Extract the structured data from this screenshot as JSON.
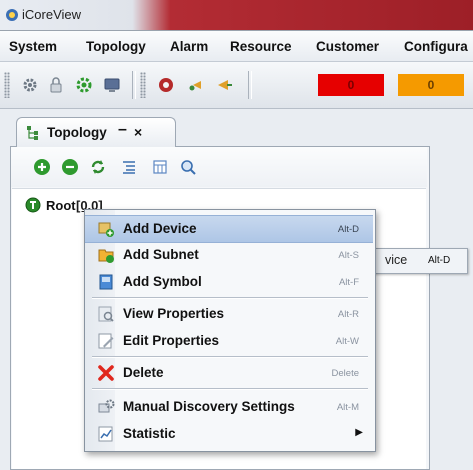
{
  "window": {
    "title": "iCoreView"
  },
  "menubar": {
    "items": [
      "System",
      "Topology",
      "Alarm",
      "Resource",
      "Customer",
      "Configura"
    ]
  },
  "toolbar": {
    "icons": [
      "settings-icon",
      "lock-icon",
      "gear-icon",
      "monitor-icon",
      "alarm-bell-icon",
      "back-icon",
      "forward-icon"
    ],
    "alarm_counts": [
      {
        "value": "0",
        "color": "#e60000"
      },
      {
        "value": "0",
        "color": "#f59a00"
      }
    ]
  },
  "tab": {
    "label": "Topology",
    "minimize": "–",
    "close": "×"
  },
  "panel_toolbar": {
    "icons": [
      "add-icon",
      "remove-icon",
      "refresh-icon",
      "list-icon",
      "calendar-icon",
      "search-icon"
    ]
  },
  "tree": {
    "root_label": "Root",
    "root_suffix": "[0.0]"
  },
  "submenu": {
    "label": "vice",
    "shortcut": "Alt-D"
  },
  "context_menu": {
    "items": [
      {
        "label": "Add Device",
        "shortcut": "Alt-D",
        "icon": "add-device-icon",
        "highlighted": true
      },
      {
        "label": "Add Subnet",
        "shortcut": "Alt-S",
        "icon": "add-subnet-icon"
      },
      {
        "label": "Add Symbol",
        "shortcut": "Alt-F",
        "icon": "add-symbol-icon"
      },
      {
        "label": "View Properties",
        "shortcut": "Alt-R",
        "icon": "view-properties-icon"
      },
      {
        "label": "Edit Properties",
        "shortcut": "Alt-W",
        "icon": "edit-properties-icon"
      },
      {
        "label": "Delete",
        "shortcut": "Delete",
        "icon": "delete-icon"
      },
      {
        "label": "Manual Discovery Settings",
        "shortcut": "Alt-M",
        "icon": "discovery-settings-icon"
      },
      {
        "label": "Statistic",
        "shortcut": "",
        "icon": "statistic-icon",
        "has_submenu": true
      }
    ]
  }
}
